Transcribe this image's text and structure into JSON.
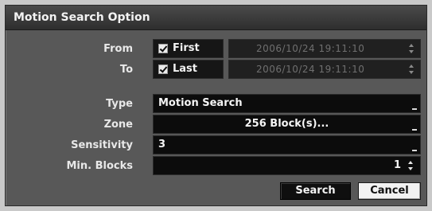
{
  "dialog": {
    "title": "Motion Search Option"
  },
  "from": {
    "label": "From",
    "checkbox": {
      "label": "First",
      "checked": true
    },
    "datetime": "2006/10/24  19:11:10"
  },
  "to": {
    "label": "To",
    "checkbox": {
      "label": "Last",
      "checked": true
    },
    "datetime": "2006/10/24  19:11:10"
  },
  "type": {
    "label": "Type",
    "value": "Motion Search"
  },
  "zone": {
    "label": "Zone",
    "value": "256 Block(s)..."
  },
  "sensitivity": {
    "label": "Sensitivity",
    "value": "3"
  },
  "min_blocks": {
    "label": "Min. Blocks",
    "value": "1"
  },
  "buttons": {
    "search": "Search",
    "cancel": "Cancel"
  },
  "icons": {
    "spinner": "up-down-arrows-icon",
    "dropdown": "dropdown-marker-icon",
    "check": "checkmark-icon"
  },
  "colors": {
    "dialog_bg": "#585858",
    "field_bg": "#0c0c0c",
    "title_bg": "#2e2e2e"
  }
}
